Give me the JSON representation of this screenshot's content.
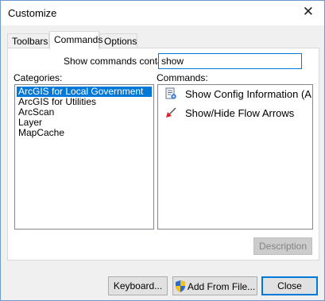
{
  "window": {
    "title": "Customize"
  },
  "tabs": [
    {
      "label": "Toolbars"
    },
    {
      "label": "Commands"
    },
    {
      "label": "Options"
    }
  ],
  "search": {
    "label": "Show commands containing:",
    "value": "show"
  },
  "categories": {
    "label": "Categories:",
    "items": [
      "ArcGIS for Local Government",
      "ArcGIS for Utilities",
      "ArcScan",
      "Layer",
      "MapCache"
    ],
    "selected_index": 0
  },
  "commands": {
    "label": "Commands:",
    "items": [
      {
        "label": "Show Config Information (A...",
        "icon": "config-info-icon"
      },
      {
        "label": "Show/Hide Flow Arrows",
        "icon": "flow-arrows-icon"
      }
    ]
  },
  "buttons": {
    "description": "Description",
    "keyboard": "Keyboard...",
    "add_from_file": "Add From File...",
    "close": "Close"
  },
  "colors": {
    "selection": "#0078d7",
    "focus_border": "#0078d7"
  }
}
